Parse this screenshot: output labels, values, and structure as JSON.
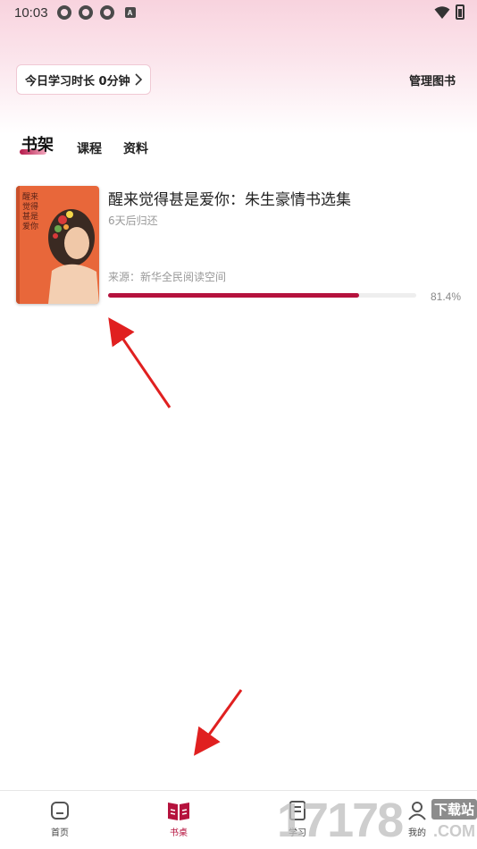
{
  "status_bar": {
    "time": "10:03",
    "notification_badge": "A"
  },
  "header": {
    "study_time_label": "今日学习时长 0分钟",
    "manage_books_label": "管理图书"
  },
  "tabs": [
    {
      "label": "书架",
      "active": true
    },
    {
      "label": "课程",
      "active": false
    },
    {
      "label": "资料",
      "active": false
    }
  ],
  "books": [
    {
      "title": "醒来觉得甚是爱你：朱生豪情书选集",
      "due": "6天后归还",
      "source": "来源：新华全民阅读空间",
      "progress_text": "81.4%",
      "progress_value": 0.814,
      "cover_text": "醒来觉得 甚是爱你"
    }
  ],
  "bottom_nav": [
    {
      "label": "首页",
      "icon": "home-icon",
      "active": false
    },
    {
      "label": "书桌",
      "icon": "book-desk-icon",
      "active": true
    },
    {
      "label": "学习",
      "icon": "study-icon",
      "active": false
    },
    {
      "label": "我的",
      "icon": "profile-icon",
      "active": false
    }
  ],
  "watermark": {
    "text": "17178",
    "subtext": "下载站",
    "domain": ".COM"
  },
  "colors": {
    "accent": "#b5123d",
    "header_pink": "#f8d3de",
    "arrow": "#e02020"
  }
}
